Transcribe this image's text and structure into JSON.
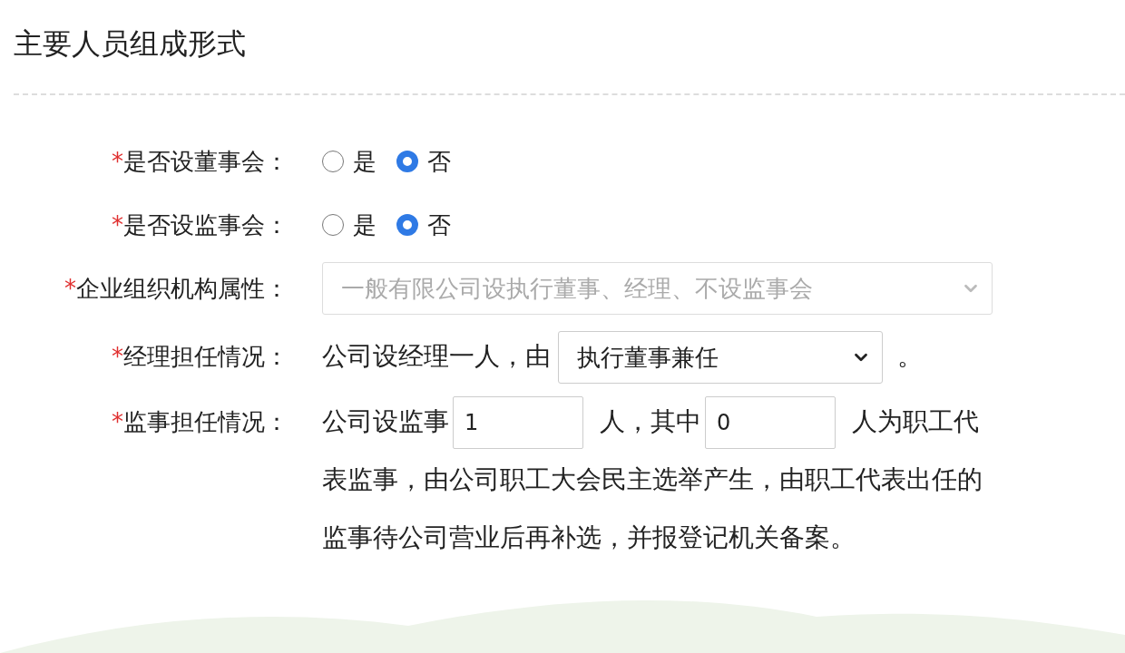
{
  "title": "主要人员组成形式",
  "fields": [
    {
      "kind": "radio",
      "required_mark": "*",
      "label": "是否设董事会：",
      "options": [
        {
          "label": "是",
          "selected": false
        },
        {
          "label": "否",
          "selected": true
        }
      ]
    },
    {
      "kind": "radio",
      "required_mark": "*",
      "label": "是否设监事会：",
      "options": [
        {
          "label": "是",
          "selected": false
        },
        {
          "label": "否",
          "selected": true
        }
      ]
    },
    {
      "kind": "select",
      "required_mark": "*",
      "label": "企业组织机构属性：",
      "value": "一般有限公司设执行董事、经理、不设监事会",
      "disabled": true
    },
    {
      "kind": "sentence",
      "required_mark": "*",
      "label": "经理担任情况：",
      "parts": [
        {
          "kind": "text",
          "text": "公司设经理一人，由"
        },
        {
          "kind": "select",
          "value": "执行董事兼任"
        },
        {
          "kind": "text",
          "text": "。"
        }
      ]
    },
    {
      "kind": "sentence",
      "required_mark": "*",
      "label": "监事担任情况：",
      "parts": [
        {
          "kind": "text",
          "text": "公司设监事"
        },
        {
          "kind": "input",
          "value": "1"
        },
        {
          "kind": "text",
          "text": "人，其中"
        },
        {
          "kind": "input",
          "value": "0"
        },
        {
          "kind": "text",
          "text": "人为职工代表监事，由公司职工大会民主选举产生，由职工代表出任的监事待公司营业后再补选，并报登记机关备案。"
        }
      ]
    }
  ]
}
